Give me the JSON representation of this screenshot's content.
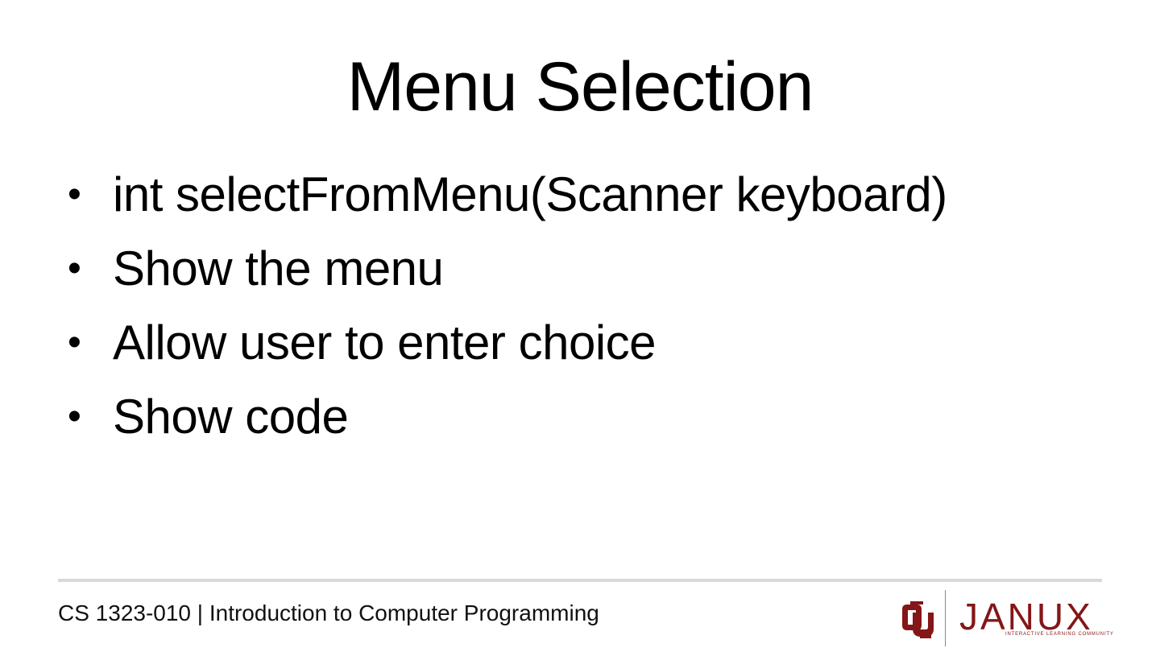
{
  "slide": {
    "title": "Menu Selection",
    "bullets": [
      {
        "bullet": "•",
        "text": "int selectFromMenu(Scanner keyboard)"
      },
      {
        "bullet": "•",
        "text": "Show the menu"
      },
      {
        "bullet": "•",
        "text": "Allow user to enter choice"
      },
      {
        "bullet": "•",
        "text": "Show code"
      }
    ]
  },
  "footer": {
    "course": "CS 1323-010 | Introduction to Computer Programming",
    "logo": {
      "icon": "ou-interlocking-logo-icon",
      "wordmark": "JANUX",
      "tagline": "INTERACTIVE LEARNING COMMUNITY",
      "brand_color": "#841617"
    },
    "rule_color": "#d9d9d9"
  }
}
